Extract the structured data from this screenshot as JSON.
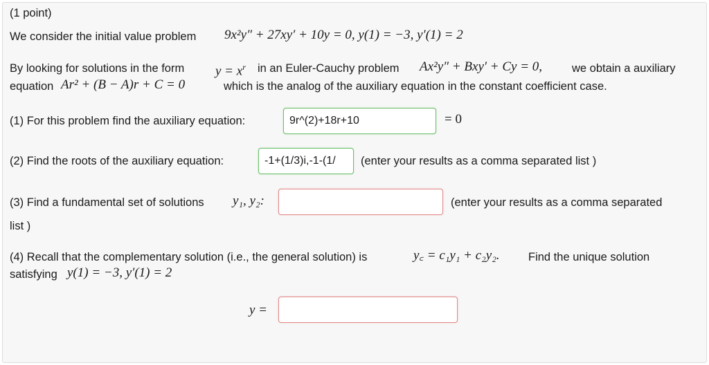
{
  "header": {
    "points": "(1 point)"
  },
  "intro": {
    "text": "We consider the initial value problem",
    "equation": "9x²y″ + 27xy′ + 10y = 0,   y(1) = −3,   y′(1) = 2"
  },
  "method": {
    "part1": "By looking for solutions in the form",
    "form": "y = x",
    "form_exp": "r",
    "part2": "in an Euler-Cauchy problem",
    "ec_eq": "Ax²y″ + Bxy′ + Cy = 0,",
    "part3": "we obtain a auxiliary",
    "part4": "equation",
    "aux_eq": "Ar² + (B − A)r + C = 0",
    "part5": "which is the analog of the auxiliary equation in the constant coefficient case."
  },
  "q1": {
    "label": "(1) For this problem find the auxiliary equation:",
    "value": "9r^(2)+18r+10",
    "suffix": "= 0"
  },
  "q2": {
    "label": "(2) Find the roots of the auxiliary equation:",
    "value": "-1+(1/3)i,-1-(1/",
    "suffix": "(enter your results as a comma separated list )"
  },
  "q3": {
    "label": "(3) Find a fundamental set of solutions",
    "vars": "y₁, y₂:",
    "value": "",
    "suffix": "(enter your results as a comma separated",
    "suffix2": "list )"
  },
  "q4": {
    "label": "(4) Recall that the complementary solution (i.e., the general solution) is",
    "yc": "y꜀ = c₁y₁ + c₂y₂.",
    "label2": "Find the unique solution",
    "label3": "satisfying",
    "cond": "y(1) = −3,   y′(1) = 2",
    "answer_label": "y =",
    "value": ""
  }
}
